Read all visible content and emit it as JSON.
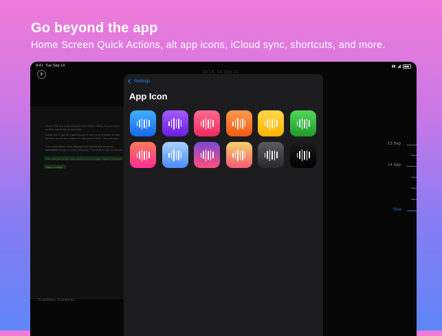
{
  "headline": "Go beyond the app",
  "subline": "Home Screen Quick Actions, alt app icons, iCloud sync, shortcuts, and more.",
  "status_bar": {
    "time": "9:41",
    "date": "Tue Sep 14"
  },
  "background": {
    "nav_title": "10:16, 14 Sep 21",
    "note_lines": [
      "Hello! This is a long notepad that retains history. As you type",
      "to view and revert at any time.",
      "Swipe left or tap the dates below to view your timeline of note",
      "timeline to pull and restore to any point in time. You can also",
      "The notes history also displays text differences between versions",
      "and strikethrough to show deletions. This feature can be turned",
      "The settings section also allows you to toggle haptics (Settings",
      "Happy writing!"
    ],
    "footer": "78 additions, 8 deletions"
  },
  "timeline": {
    "labels": [
      "13 Sep",
      "14 Sep",
      "Now"
    ]
  },
  "modal": {
    "back_label": "Settings",
    "title": "App Icon",
    "icons": [
      {
        "name": "blue-icon",
        "colors": [
          "#3fb0ff",
          "#1a66f0"
        ]
      },
      {
        "name": "purple-icon",
        "colors": [
          "#a35cff",
          "#6a1de0"
        ]
      },
      {
        "name": "pink-icon",
        "colors": [
          "#ff6a8e",
          "#f02a62"
        ]
      },
      {
        "name": "orange-icon",
        "colors": [
          "#ff9a4a",
          "#f55a12"
        ]
      },
      {
        "name": "yellow-icon",
        "colors": [
          "#ffd84a",
          "#ffb300"
        ]
      },
      {
        "name": "green-icon",
        "colors": [
          "#4fd65a",
          "#1e9b2a"
        ]
      },
      {
        "name": "sunset-icon",
        "colors": [
          "#ff7a5a",
          "#ff2d95"
        ]
      },
      {
        "name": "sky-icon",
        "colors": [
          "#a9d2ff",
          "#4a8cff"
        ]
      },
      {
        "name": "violet-fade-icon",
        "colors": [
          "#7a4ad6",
          "#ff4d7a"
        ]
      },
      {
        "name": "peach-icon",
        "colors": [
          "#f2d26a",
          "#ff5a73"
        ]
      },
      {
        "name": "graphite-icon",
        "colors": [
          "#5a5a5e",
          "#2a2a2c"
        ]
      },
      {
        "name": "black-icon",
        "colors": [
          "#1a1a1a",
          "#000000"
        ]
      }
    ]
  }
}
